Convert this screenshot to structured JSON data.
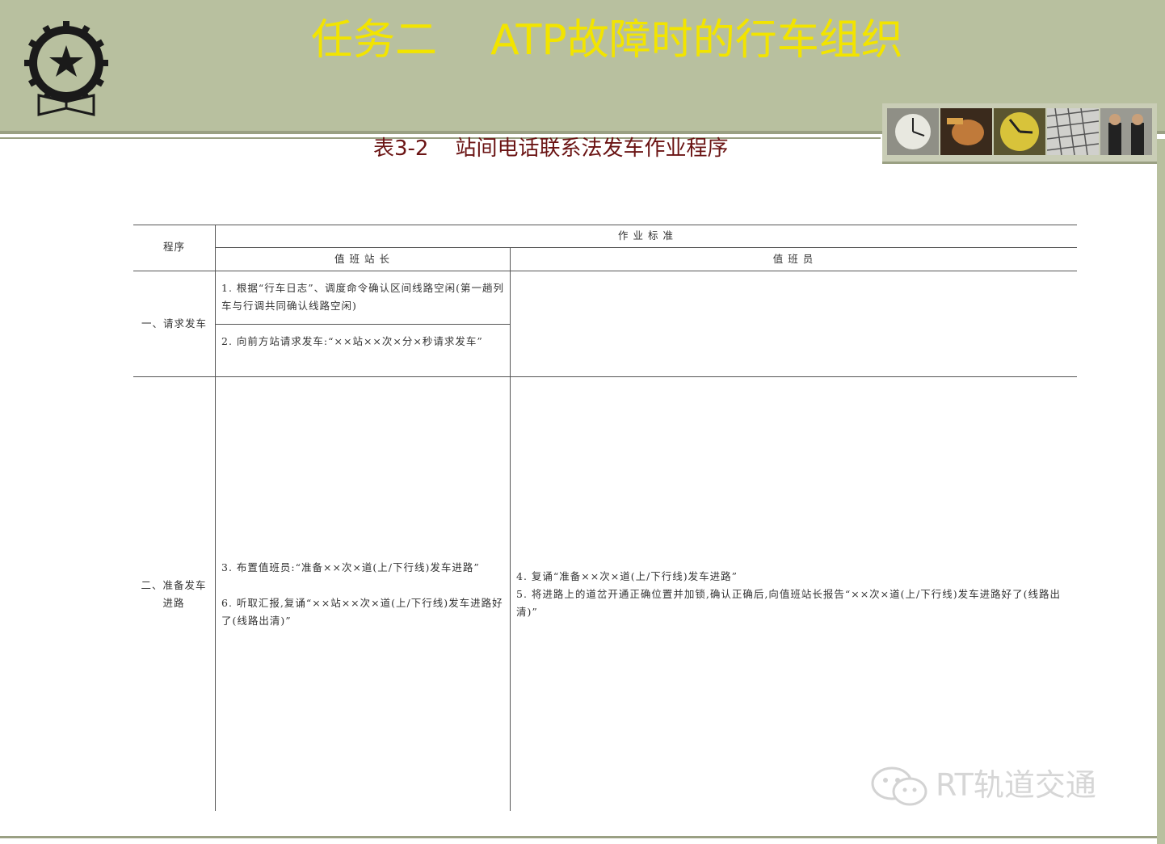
{
  "header": {
    "title": "任务二    ATP故障时的行车组织",
    "subtitle": "表3-2    站间电话联系法发车作业程序"
  },
  "table": {
    "col_procedure": "程序",
    "col_standard": "作 业 标 准",
    "col_station_master": "值 班 站 长",
    "col_duty_officer": "值 班 员",
    "rows": [
      {
        "procedure": "一、请求发车",
        "master_items": [
          "1. 根据“行车日志”、调度命令确认区间线路空闲(第一趟列车与行调共同确认线路空闲)",
          "2. 向前方站请求发车:“××站××次×分×秒请求发车”"
        ],
        "duty_items": []
      },
      {
        "procedure": "二、准备发车进路",
        "master_items": [
          "3. 布置值班员:“准备××次×道(上/下行线)发车进路”",
          "6. 听取汇报,复诵“××站××次×道(上/下行线)发车进路好了(线路出清)”"
        ],
        "duty_items": [
          "4. 复诵“准备××次×道(上/下行线)发车进路”",
          "5. 将进路上的道岔开通正确位置并加锁,确认正确后,向值班站长报告“××次×道(上/下行线)发车进路好了(线路出清)”"
        ]
      }
    ]
  },
  "watermark": {
    "text": "RT轨道交通",
    "icon": "wechat-icon"
  },
  "colors": {
    "header_band": "#b8c09f",
    "title": "#f2e400",
    "subtitle": "#6b1414"
  }
}
